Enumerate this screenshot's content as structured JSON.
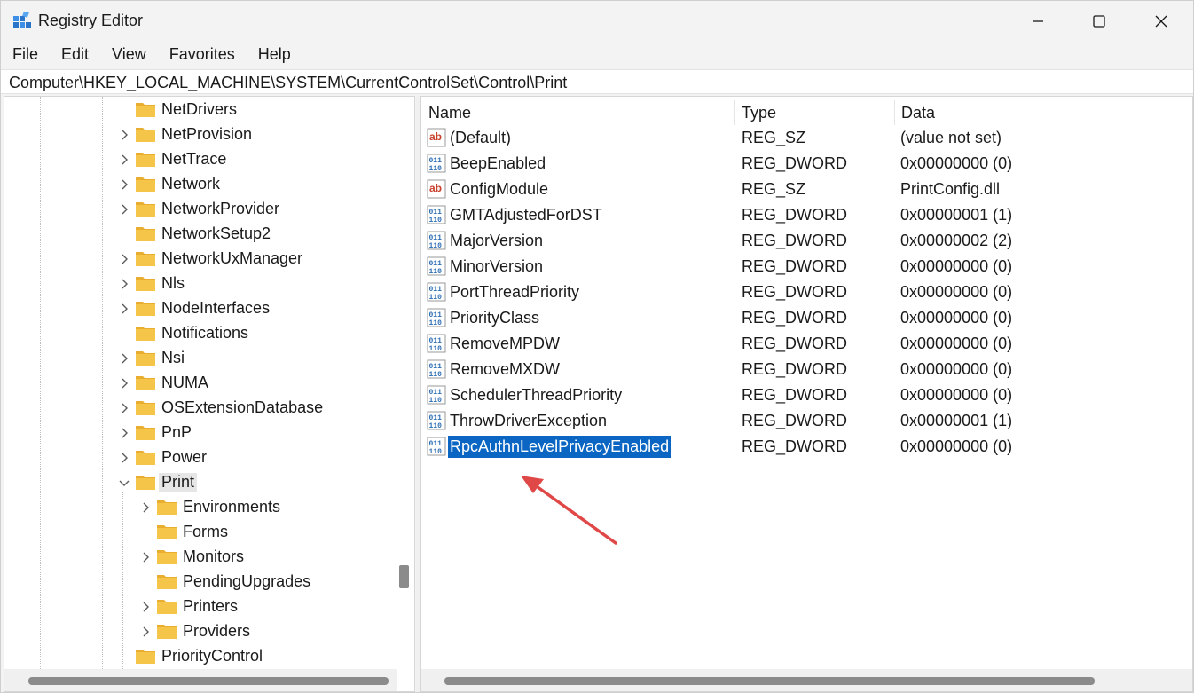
{
  "window": {
    "title": "Registry Editor",
    "icons": {
      "app": "registry-icon",
      "minimize": "minimize-icon",
      "maximize": "maximize-icon",
      "close": "close-icon"
    }
  },
  "menu": {
    "items": [
      "File",
      "Edit",
      "View",
      "Favorites",
      "Help"
    ]
  },
  "address": {
    "path": "Computer\\HKEY_LOCAL_MACHINE\\SYSTEM\\CurrentControlSet\\Control\\Print"
  },
  "tree": {
    "items": [
      {
        "label": "NetDrivers",
        "expander": "none",
        "level": 0
      },
      {
        "label": "NetProvision",
        "expander": "collapsed",
        "level": 0
      },
      {
        "label": "NetTrace",
        "expander": "collapsed",
        "level": 0
      },
      {
        "label": "Network",
        "expander": "collapsed",
        "level": 0
      },
      {
        "label": "NetworkProvider",
        "expander": "collapsed",
        "level": 0
      },
      {
        "label": "NetworkSetup2",
        "expander": "none",
        "level": 0
      },
      {
        "label": "NetworkUxManager",
        "expander": "collapsed",
        "level": 0
      },
      {
        "label": "Nls",
        "expander": "collapsed",
        "level": 0
      },
      {
        "label": "NodeInterfaces",
        "expander": "collapsed",
        "level": 0
      },
      {
        "label": "Notifications",
        "expander": "none",
        "level": 0
      },
      {
        "label": "Nsi",
        "expander": "collapsed",
        "level": 0
      },
      {
        "label": "NUMA",
        "expander": "collapsed",
        "level": 0
      },
      {
        "label": "OSExtensionDatabase",
        "expander": "collapsed",
        "level": 0
      },
      {
        "label": "PnP",
        "expander": "collapsed",
        "level": 0
      },
      {
        "label": "Power",
        "expander": "collapsed",
        "level": 0
      },
      {
        "label": "Print",
        "expander": "expanded",
        "level": 0,
        "selected": true
      },
      {
        "label": "Environments",
        "expander": "collapsed",
        "level": 1
      },
      {
        "label": "Forms",
        "expander": "none",
        "level": 1
      },
      {
        "label": "Monitors",
        "expander": "collapsed",
        "level": 1
      },
      {
        "label": "PendingUpgrades",
        "expander": "none",
        "level": 1
      },
      {
        "label": "Printers",
        "expander": "collapsed",
        "level": 1
      },
      {
        "label": "Providers",
        "expander": "collapsed",
        "level": 1
      },
      {
        "label": "PriorityControl",
        "expander": "none",
        "level": 0
      }
    ]
  },
  "list": {
    "headers": {
      "name": "Name",
      "type": "Type",
      "data": "Data"
    },
    "rows": [
      {
        "name": "(Default)",
        "type": "REG_SZ",
        "data": "(value not set)",
        "icon": "string-value-icon"
      },
      {
        "name": "BeepEnabled",
        "type": "REG_DWORD",
        "data": "0x00000000 (0)",
        "icon": "binary-value-icon"
      },
      {
        "name": "ConfigModule",
        "type": "REG_SZ",
        "data": "PrintConfig.dll",
        "icon": "string-value-icon"
      },
      {
        "name": "GMTAdjustedForDST",
        "type": "REG_DWORD",
        "data": "0x00000001 (1)",
        "icon": "binary-value-icon"
      },
      {
        "name": "MajorVersion",
        "type": "REG_DWORD",
        "data": "0x00000002 (2)",
        "icon": "binary-value-icon"
      },
      {
        "name": "MinorVersion",
        "type": "REG_DWORD",
        "data": "0x00000000 (0)",
        "icon": "binary-value-icon"
      },
      {
        "name": "PortThreadPriority",
        "type": "REG_DWORD",
        "data": "0x00000000 (0)",
        "icon": "binary-value-icon"
      },
      {
        "name": "PriorityClass",
        "type": "REG_DWORD",
        "data": "0x00000000 (0)",
        "icon": "binary-value-icon"
      },
      {
        "name": "RemoveMPDW",
        "type": "REG_DWORD",
        "data": "0x00000000 (0)",
        "icon": "binary-value-icon"
      },
      {
        "name": "RemoveMXDW",
        "type": "REG_DWORD",
        "data": "0x00000000 (0)",
        "icon": "binary-value-icon"
      },
      {
        "name": "SchedulerThreadPriority",
        "type": "REG_DWORD",
        "data": "0x00000000 (0)",
        "icon": "binary-value-icon"
      },
      {
        "name": "ThrowDriverException",
        "type": "REG_DWORD",
        "data": "0x00000001 (1)",
        "icon": "binary-value-icon"
      },
      {
        "name": "RpcAuthnLevelPrivacyEnabled",
        "type": "REG_DWORD",
        "data": "0x00000000 (0)",
        "icon": "binary-value-icon",
        "selected": true
      }
    ]
  },
  "annotation": {
    "icon": "red-arrow-icon",
    "color": "#e04848"
  },
  "colors": {
    "selection": "#0a66c2",
    "folder": "#f5c54a",
    "string_icon": "#c9402c",
    "binary_icon": "#2f6fb5"
  }
}
